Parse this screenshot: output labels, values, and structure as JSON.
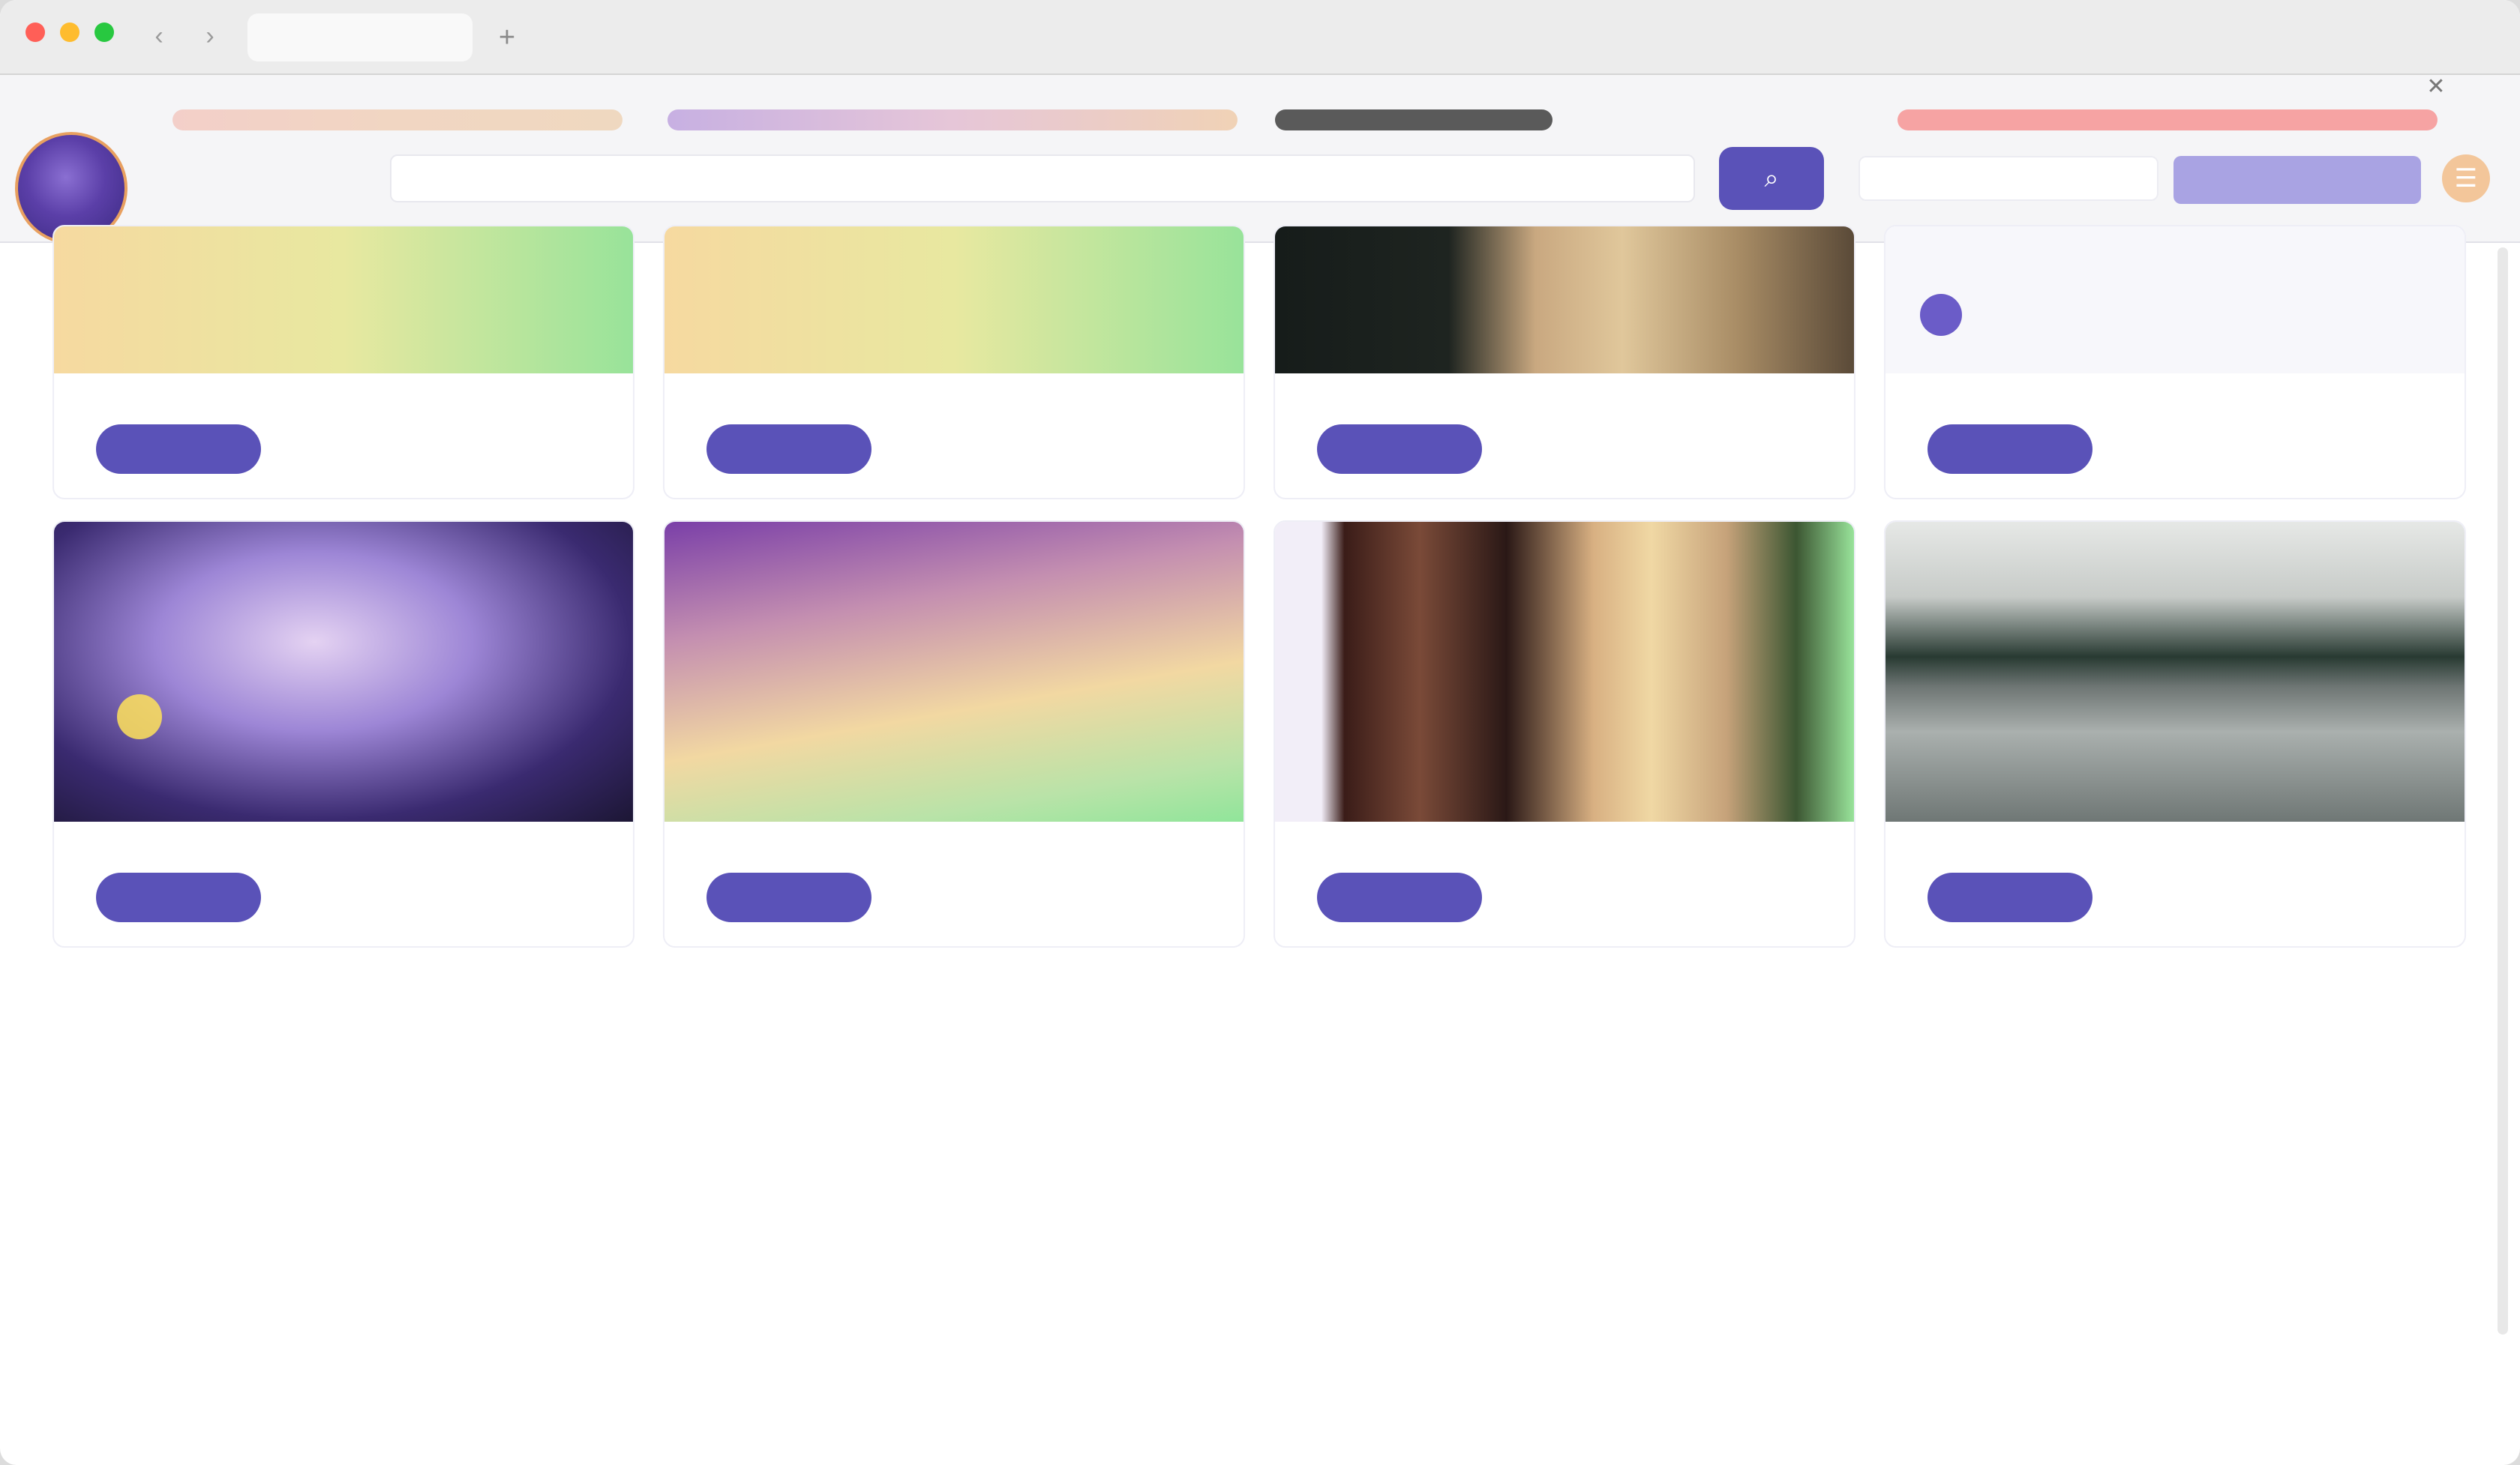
{
  "browser": {
    "back_icon": "‹",
    "forward_icon": "›",
    "new_tab_icon": "+"
  },
  "header": {
    "accent_color": "#5a52b8",
    "nav_link_1": "",
    "nav_link_2": "",
    "search_placeholder": "",
    "search_button_icon": "⌕",
    "secondary_button": "",
    "menu_icon": "☰",
    "corner_icon": "✕"
  },
  "cards": [
    {
      "title": "",
      "text": "",
      "link": "",
      "button": ""
    },
    {
      "title": "",
      "text": "",
      "link": "",
      "button": ""
    },
    {
      "title": "",
      "text": "",
      "link": "",
      "button": ""
    },
    {
      "title": "",
      "text": "",
      "link": "",
      "button": "",
      "avatar_name": ""
    },
    {
      "title": "",
      "text": "",
      "link": "",
      "button": ""
    },
    {
      "title": "",
      "text": "",
      "link": "",
      "button": ""
    },
    {
      "title": "",
      "text": "",
      "link": "",
      "button": ""
    },
    {
      "title": "",
      "text": "",
      "link": "",
      "button": ""
    }
  ]
}
